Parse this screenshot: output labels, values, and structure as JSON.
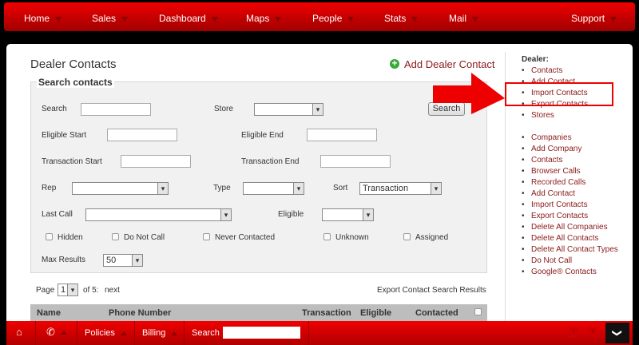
{
  "nav": [
    "Home",
    "Sales",
    "Dashboard",
    "Maps",
    "People",
    "Stats",
    "Mail",
    "Support"
  ],
  "page_title": "Dealer Contacts",
  "add_link": "Add Dealer Contact",
  "search_legend": "Search contacts",
  "form": {
    "search": "Search",
    "store": "Store",
    "search_button": "Search",
    "eligible_start": "Eligible Start",
    "eligible_end": "Eligible End",
    "transaction_start": "Transaction Start",
    "transaction_end": "Transaction End",
    "rep": "Rep",
    "type": "Type",
    "sort": "Sort",
    "sort_value": "Transaction",
    "last_call": "Last Call",
    "eligible": "Eligible",
    "hidden": "Hidden",
    "do_not_call": "Do Not Call",
    "never_contacted": "Never Contacted",
    "unknown": "Unknown",
    "assigned": "Assigned",
    "max_results": "Max Results",
    "max_results_value": "50"
  },
  "pager": {
    "page": "Page",
    "value": "1",
    "of": "of 5:",
    "next": "next",
    "export": "Export Contact Search Results"
  },
  "table_headers": [
    "Name",
    "Phone Number",
    "Transaction",
    "Eligible",
    "Contacted"
  ],
  "sidebar": {
    "heading": "Dealer:",
    "group1": [
      "Contacts",
      "Add Contact",
      "Import Contacts",
      "Export Contacts",
      "Stores"
    ],
    "group2": [
      "Companies",
      "Add Company",
      "Contacts",
      "Browser Calls",
      "Recorded Calls",
      "Add Contact",
      "Import Contacts",
      "Export Contacts",
      "Delete All Companies",
      "Delete All Contacts",
      "Delete All Contact Types",
      "Do Not Call",
      "Google® Contacts"
    ]
  },
  "bottom": {
    "policies": "Policies",
    "billing": "Billing",
    "search": "Search"
  }
}
